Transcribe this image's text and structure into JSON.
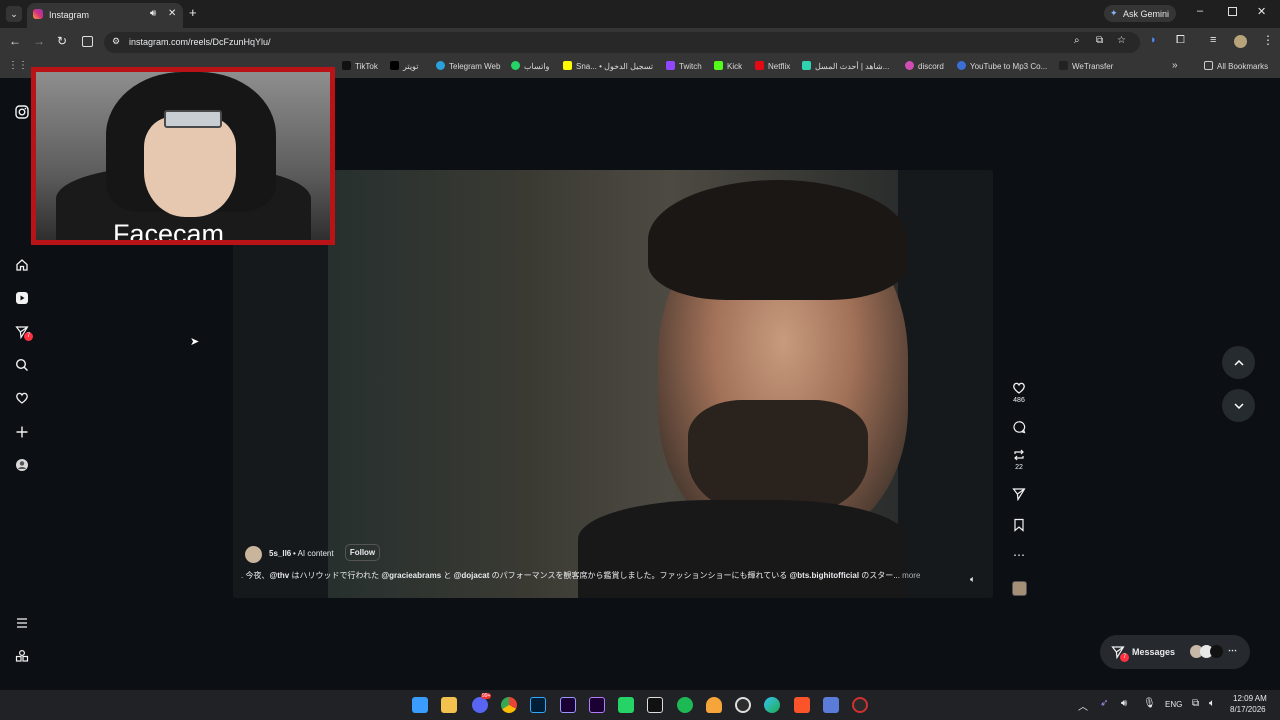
{
  "browser": {
    "tab_title": "Instagram",
    "url": "instagram.com/reels/DcFzunHqYlu/",
    "ask_gemini": "Ask Gemini",
    "all_bookmarks": "All Bookmarks",
    "bookmarks": [
      "TikTok",
      "تويتر",
      "Telegram Web",
      "واتساب",
      "Sna... • تسجيل الدخول",
      "Twitch",
      "Kick",
      "Netflix",
      "شاهد | أحدث المسل...",
      "discord",
      "YouTube to Mp3 Co...",
      "WeTransfer"
    ]
  },
  "sidebar": {
    "notification_badge": "7"
  },
  "facecam": {
    "label": "Facecam"
  },
  "reel": {
    "username": "5s_ll6",
    "ai_label": "• AI content",
    "follow": "Follow",
    "caption_prefix": ". 今夜、",
    "caption_tag1": "@thv",
    "caption_mid1": " はハリウッドで行われた ",
    "caption_tag2": "@gracieabrams",
    "caption_mid2": " と ",
    "caption_tag3": "@dojacat",
    "caption_mid3": " のパフォーマンスを観客席から鑑賞しました。ファッションショーにも輝れている ",
    "caption_tag4": "@bts.bighitofficial",
    "caption_end": " のスター... ",
    "more": "more",
    "likes": "486",
    "reposts": "22"
  },
  "messages": {
    "label": "Messages",
    "badge": "7"
  },
  "taskbar": {
    "time": "12:09 AM",
    "date": "8/17/2026",
    "lang": "ENG",
    "discord_badge": "99+"
  },
  "colors": {
    "accent_red": "#b91318",
    "badge_red": "#ff3040"
  }
}
